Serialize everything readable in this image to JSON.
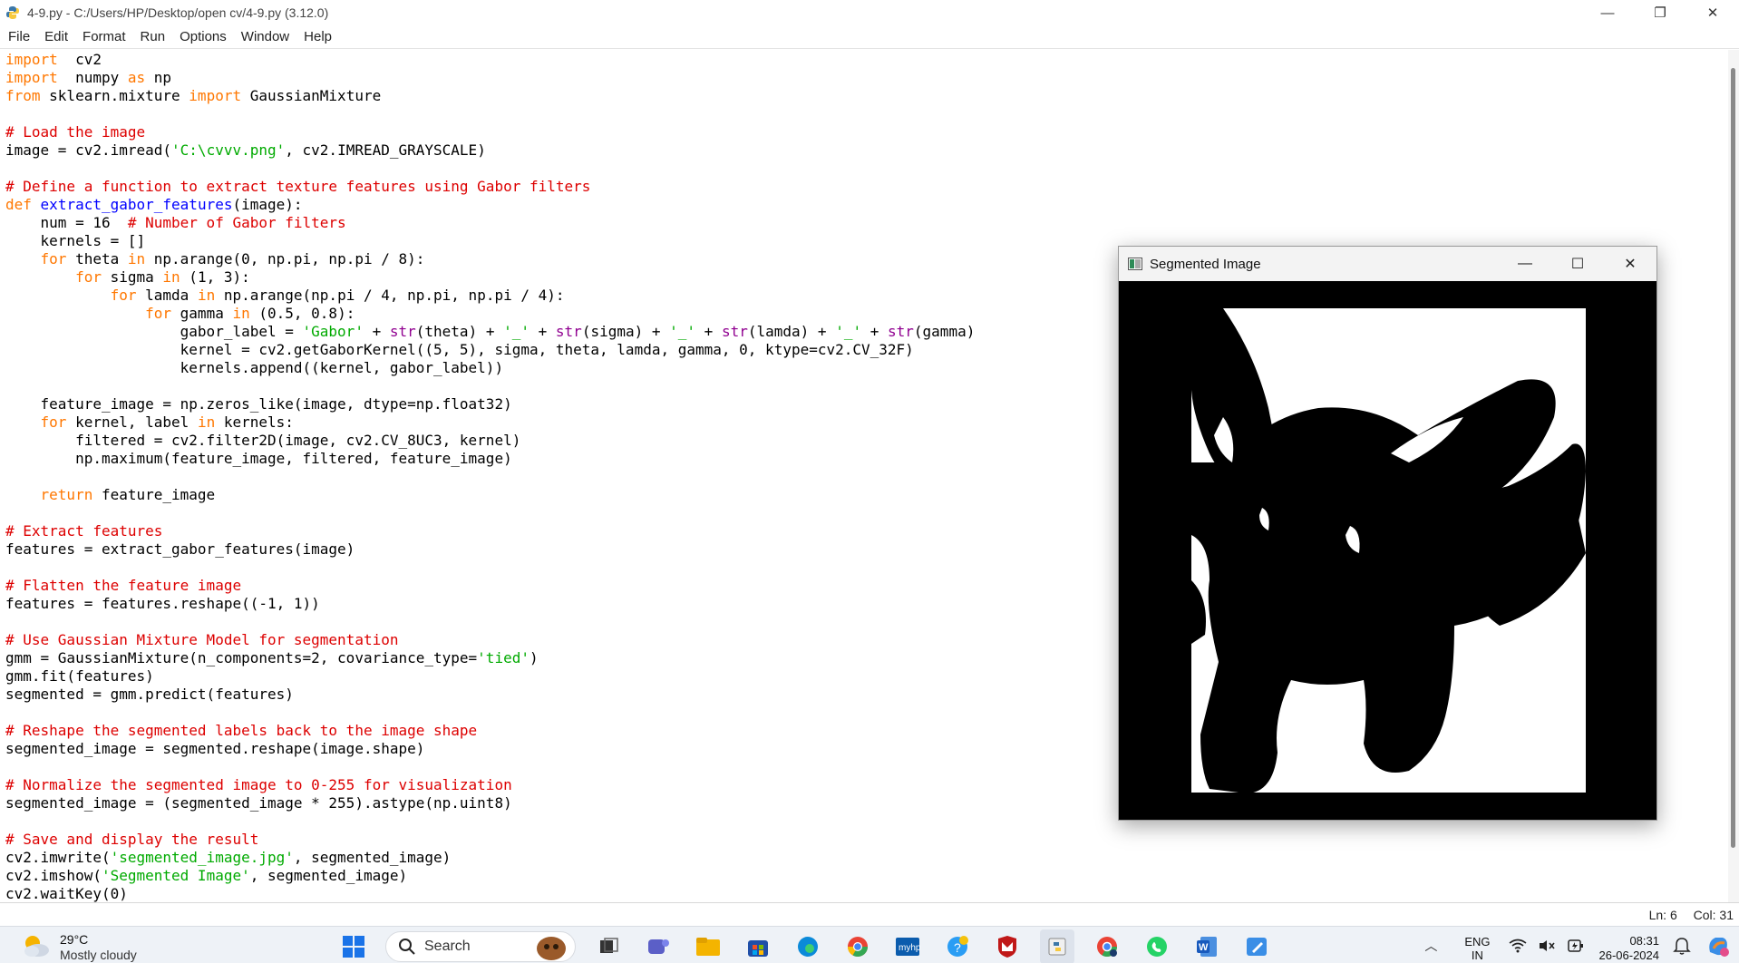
{
  "window": {
    "title": "4-9.py - C:/Users/HP/Desktop/open cv/4-9.py (3.12.0)",
    "controls": {
      "minimize": "—",
      "restore": "❐",
      "close": "✕"
    }
  },
  "menu": [
    "File",
    "Edit",
    "Format",
    "Run",
    "Options",
    "Window",
    "Help"
  ],
  "code_lines": [
    [
      [
        "kw",
        "import"
      ],
      [
        "",
        "  cv2"
      ]
    ],
    [
      [
        "kw",
        "import"
      ],
      [
        "",
        "  numpy "
      ],
      [
        "kw",
        "as"
      ],
      [
        "",
        " np"
      ]
    ],
    [
      [
        "kw",
        "from"
      ],
      [
        "",
        " sklearn.mixture "
      ],
      [
        "kw",
        "import"
      ],
      [
        "",
        " GaussianMixture"
      ]
    ],
    [
      [
        "",
        ""
      ]
    ],
    [
      [
        "cm",
        "# Load the image"
      ]
    ],
    [
      [
        "",
        "image = cv2.imread("
      ],
      [
        "st",
        "'C:\\cvvv.png'"
      ],
      [
        "",
        ", cv2.IMREAD_GRAYSCALE)"
      ]
    ],
    [
      [
        "",
        ""
      ]
    ],
    [
      [
        "cm",
        "# Define a function to extract texture features using Gabor filters"
      ]
    ],
    [
      [
        "kw",
        "def"
      ],
      [
        "",
        " "
      ],
      [
        "df",
        "extract_gabor_features"
      ],
      [
        "",
        "(image):"
      ]
    ],
    [
      [
        "",
        "    num = 16  "
      ],
      [
        "cm",
        "# Number of Gabor filters"
      ]
    ],
    [
      [
        "",
        "    kernels = []"
      ]
    ],
    [
      [
        "",
        "    "
      ],
      [
        "kw",
        "for"
      ],
      [
        "",
        " theta "
      ],
      [
        "kw",
        "in"
      ],
      [
        "",
        " np.arange(0, np.pi, np.pi / 8):"
      ]
    ],
    [
      [
        "",
        "        "
      ],
      [
        "kw",
        "for"
      ],
      [
        "",
        " sigma "
      ],
      [
        "kw",
        "in"
      ],
      [
        "",
        " (1, 3):"
      ]
    ],
    [
      [
        "",
        "            "
      ],
      [
        "kw",
        "for"
      ],
      [
        "",
        " lamda "
      ],
      [
        "kw",
        "in"
      ],
      [
        "",
        " np.arange(np.pi / 4, np.pi, np.pi / 4):"
      ]
    ],
    [
      [
        "",
        "                "
      ],
      [
        "kw",
        "for"
      ],
      [
        "",
        " gamma "
      ],
      [
        "kw",
        "in"
      ],
      [
        "",
        " (0.5, 0.8):"
      ]
    ],
    [
      [
        "",
        "                    gabor_label = "
      ],
      [
        "st",
        "'Gabor'"
      ],
      [
        "",
        " + "
      ],
      [
        "bi",
        "str"
      ],
      [
        "",
        "(theta) + "
      ],
      [
        "st",
        "'_'"
      ],
      [
        "",
        " + "
      ],
      [
        "bi",
        "str"
      ],
      [
        "",
        "(sigma) + "
      ],
      [
        "st",
        "'_'"
      ],
      [
        "",
        " + "
      ],
      [
        "bi",
        "str"
      ],
      [
        "",
        "(lamda) + "
      ],
      [
        "st",
        "'_'"
      ],
      [
        "",
        " + "
      ],
      [
        "bi",
        "str"
      ],
      [
        "",
        "(gamma)"
      ]
    ],
    [
      [
        "",
        "                    kernel = cv2.getGaborKernel((5, 5), sigma, theta, lamda, gamma, 0, ktype=cv2.CV_32F)"
      ]
    ],
    [
      [
        "",
        "                    kernels.append((kernel, gabor_label))"
      ]
    ],
    [
      [
        "",
        ""
      ]
    ],
    [
      [
        "",
        "    feature_image = np.zeros_like(image, dtype=np.float32)"
      ]
    ],
    [
      [
        "",
        "    "
      ],
      [
        "kw",
        "for"
      ],
      [
        "",
        " kernel, label "
      ],
      [
        "kw",
        "in"
      ],
      [
        "",
        " kernels:"
      ]
    ],
    [
      [
        "",
        "        filtered = cv2.filter2D(image, cv2.CV_8UC3, kernel)"
      ]
    ],
    [
      [
        "",
        "        np.maximum(feature_image, filtered, feature_image)"
      ]
    ],
    [
      [
        "",
        ""
      ]
    ],
    [
      [
        "",
        "    "
      ],
      [
        "kw",
        "return"
      ],
      [
        "",
        " feature_image"
      ]
    ],
    [
      [
        "",
        ""
      ]
    ],
    [
      [
        "cm",
        "# Extract features"
      ]
    ],
    [
      [
        "",
        "features = extract_gabor_features(image)"
      ]
    ],
    [
      [
        "",
        ""
      ]
    ],
    [
      [
        "cm",
        "# Flatten the feature image"
      ]
    ],
    [
      [
        "",
        "features = features.reshape((-1, 1))"
      ]
    ],
    [
      [
        "",
        ""
      ]
    ],
    [
      [
        "cm",
        "# Use Gaussian Mixture Model for segmentation"
      ]
    ],
    [
      [
        "",
        "gmm = GaussianMixture(n_components=2, covariance_type="
      ],
      [
        "st",
        "'tied'"
      ],
      [
        "",
        ")"
      ]
    ],
    [
      [
        "",
        "gmm.fit(features)"
      ]
    ],
    [
      [
        "",
        "segmented = gmm.predict(features)"
      ]
    ],
    [
      [
        "",
        ""
      ]
    ],
    [
      [
        "cm",
        "# Reshape the segmented labels back to the image shape"
      ]
    ],
    [
      [
        "",
        "segmented_image = segmented.reshape(image.shape)"
      ]
    ],
    [
      [
        "",
        ""
      ]
    ],
    [
      [
        "cm",
        "# Normalize the segmented image to 0-255 for visualization"
      ]
    ],
    [
      [
        "",
        "segmented_image = (segmented_image * 255).astype(np.uint8)"
      ]
    ],
    [
      [
        "",
        ""
      ]
    ],
    [
      [
        "cm",
        "# Save and display the result"
      ]
    ],
    [
      [
        "",
        "cv2.imwrite("
      ],
      [
        "st",
        "'segmented_image.jpg'"
      ],
      [
        "",
        ", segmented_image)"
      ]
    ],
    [
      [
        "",
        "cv2.imshow("
      ],
      [
        "st",
        "'Segmented Image'"
      ],
      [
        "",
        ", segmented_image)"
      ]
    ],
    [
      [
        "",
        "cv2.waitKey(0)"
      ]
    ]
  ],
  "status": {
    "line": "Ln: 6",
    "col": "Col: 31"
  },
  "cv_window": {
    "title": "Segmented Image",
    "controls": {
      "minimize": "—",
      "maximize": "☐",
      "close": "✕"
    }
  },
  "taskbar": {
    "weather": {
      "temp": "29°C",
      "condition": "Mostly cloudy"
    },
    "search_label": "Search",
    "pinned_icons": [
      "windows-start-icon",
      "search-icon",
      "widget-icon",
      "task-view-icon",
      "teams-icon",
      "file-explorer-icon",
      "store-icon",
      "edge-icon",
      "chrome-icon",
      "myhp-icon",
      "help-icon",
      "mcafee-icon",
      "python-idle-icon",
      "chrome-profile-icon",
      "whatsapp-icon",
      "word-icon",
      "paint-icon"
    ],
    "tray": {
      "language_top": "ENG",
      "language_bottom": "IN",
      "time": "08:31",
      "date": "26-06-2024"
    }
  },
  "colors": {
    "keyword": "#ff7700",
    "comment": "#dd0000",
    "string": "#00aa00",
    "builtin": "#900090",
    "definition": "#0000ff"
  }
}
